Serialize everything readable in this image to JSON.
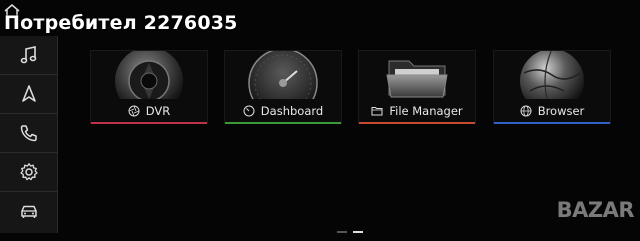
{
  "watermark": {
    "text": "Потребител 2276035"
  },
  "sidebar": {
    "items": [
      {
        "name": "music",
        "icon": "music-note-icon"
      },
      {
        "name": "navigation",
        "icon": "navigation-arrow-icon"
      },
      {
        "name": "phone",
        "icon": "phone-icon"
      },
      {
        "name": "settings",
        "icon": "gear-icon"
      },
      {
        "name": "car",
        "icon": "car-icon"
      }
    ]
  },
  "apps": [
    {
      "label": "DVR",
      "icon": "camera-aperture-icon",
      "accent": "#c0324a"
    },
    {
      "label": "Dashboard",
      "icon": "speedometer-icon",
      "accent": "#3a9a3a"
    },
    {
      "label": "File Manager",
      "icon": "folder-icon",
      "accent": "#c84a30"
    },
    {
      "label": "Browser",
      "icon": "globe-icon",
      "accent": "#3060c8"
    }
  ],
  "pager": {
    "pages": 2,
    "active_page": 2
  },
  "footer": {
    "logo_text": "BAZAR"
  }
}
